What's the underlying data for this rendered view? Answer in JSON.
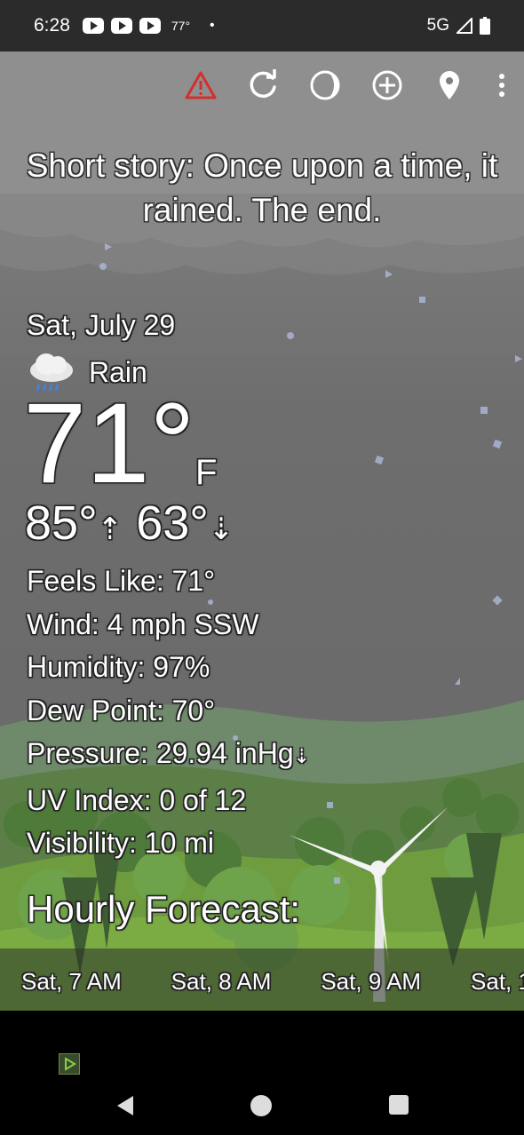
{
  "status_bar": {
    "time": "6:28",
    "temp": "77°",
    "dot": "•",
    "network": "5G"
  },
  "toolbar": {
    "items": [
      {
        "icon": "warning-icon",
        "color": "#d32f2f"
      },
      {
        "icon": "refresh-icon"
      },
      {
        "icon": "moon-phase-icon"
      },
      {
        "icon": "add-location-icon"
      },
      {
        "icon": "location-pin-icon"
      },
      {
        "icon": "more-vert-icon"
      }
    ]
  },
  "headline": "Short story: Once upon a time, it rained. The end.",
  "current": {
    "date": "Sat, July 29",
    "condition": "Rain",
    "condition_icon": "rain-cloud-icon",
    "temperature": "71°",
    "unit": "F",
    "high": "85°",
    "low": "63°"
  },
  "details": {
    "feels_like": "Feels Like:  71°",
    "wind": "Wind:  4 mph SSW",
    "humidity": "Humidity:  97%",
    "dew_point": "Dew Point:  70°",
    "pressure": "Pressure:  29.94 inHg",
    "uv_index": "UV Index:  0 of 12",
    "visibility": "Visibility:  10 mi"
  },
  "hourly": {
    "title": "Hourly Forecast:",
    "hours": [
      "Sat, 7 AM",
      "Sat, 8 AM",
      "Sat, 9 AM",
      "Sat, 1"
    ]
  },
  "colors": {
    "status_bar": "#2b2b2b",
    "sky": "#7a7a7a",
    "hills": "#5e8f3e",
    "warning": "#d32f2f"
  }
}
